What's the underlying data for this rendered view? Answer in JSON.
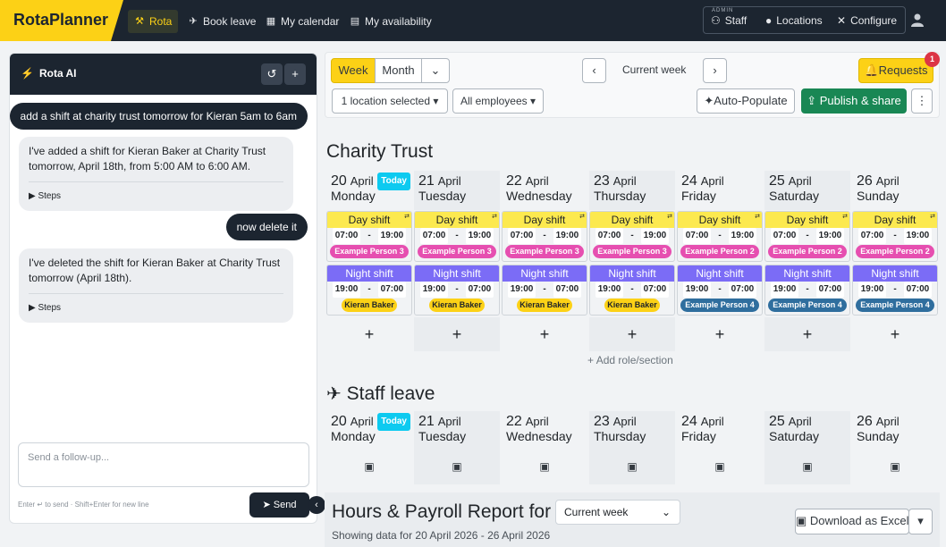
{
  "navbar": {
    "brand": "RotaPlanner",
    "items": [
      {
        "label": "Rota",
        "icon": "rota-icon"
      },
      {
        "label": "Book leave",
        "icon": "plane-icon"
      },
      {
        "label": "My calendar",
        "icon": "calendar-icon"
      },
      {
        "label": "My availability",
        "icon": "availability-icon"
      }
    ],
    "admin": {
      "tag": "ADMIN",
      "items": [
        {
          "label": "Staff",
          "icon": "staff-icon"
        },
        {
          "label": "Locations",
          "icon": "location-pin-icon"
        },
        {
          "label": "Configure",
          "icon": "wrench-icon"
        }
      ]
    }
  },
  "chat": {
    "title": "Rota AI",
    "messages": [
      {
        "role": "user",
        "text": "add a shift at charity trust tomorrow for Kieran 5am to 6am"
      },
      {
        "role": "ai",
        "text": "I've added a shift for Kieran Baker at Charity Trust tomorrow, April 18th, from 5:00 AM to 6:00 AM.",
        "steps": "Steps"
      },
      {
        "role": "user",
        "text": "now delete it"
      },
      {
        "role": "ai",
        "text": "I've deleted the shift for Kieran Baker at Charity Trust tomorrow (April 18th).",
        "steps": "Steps"
      }
    ],
    "input_placeholder": "Send a follow-up...",
    "hint": "Enter ↵ to send · Shift+Enter for new line",
    "send_label": "Send"
  },
  "toolbar": {
    "week": "Week",
    "month": "Month",
    "current_week": "Current week",
    "requests": "Requests",
    "requests_count": "1",
    "location_filter": "1 location selected",
    "employee_filter": "All employees",
    "auto_populate": "Auto-Populate",
    "publish": "Publish & share"
  },
  "rota": {
    "location": "Charity Trust",
    "today_label": "Today",
    "days": [
      {
        "num": "20",
        "month": "April",
        "name": "Monday"
      },
      {
        "num": "21",
        "month": "April",
        "name": "Tuesday"
      },
      {
        "num": "22",
        "month": "April",
        "name": "Wednesday"
      },
      {
        "num": "23",
        "month": "April",
        "name": "Thursday"
      },
      {
        "num": "24",
        "month": "April",
        "name": "Friday"
      },
      {
        "num": "25",
        "month": "April",
        "name": "Saturday"
      },
      {
        "num": "26",
        "month": "April",
        "name": "Sunday"
      }
    ],
    "day_shift": {
      "label": "Day shift",
      "start": "07:00",
      "end": "19:00",
      "employees": [
        "Example Person 3",
        "Example Person 3",
        "Example Person 3",
        "Example Person 3",
        "Example Person 2",
        "Example Person 2",
        "Example Person 2"
      ]
    },
    "night_shift": {
      "label": "Night shift",
      "start": "19:00",
      "end": "07:00",
      "employees": [
        "Kieran Baker",
        "Kieran Baker",
        "Kieran Baker",
        "Kieran Baker",
        "Example Person 4",
        "Example Person 4",
        "Example Person 4"
      ]
    },
    "add_role": "Add role/section",
    "separator": "-"
  },
  "leave": {
    "title": "Staff leave"
  },
  "report": {
    "title": "Hours & Payroll Report for",
    "period": "Current week",
    "subtitle": "Showing data for 20 April 2026 - 26 April 2026",
    "download": "Download as Excel"
  },
  "colors": {
    "brand": "#fcd116",
    "navbar": "#1c2530",
    "publish": "#198754",
    "night": "#7b6cf6",
    "today": "#0dcaf0"
  }
}
